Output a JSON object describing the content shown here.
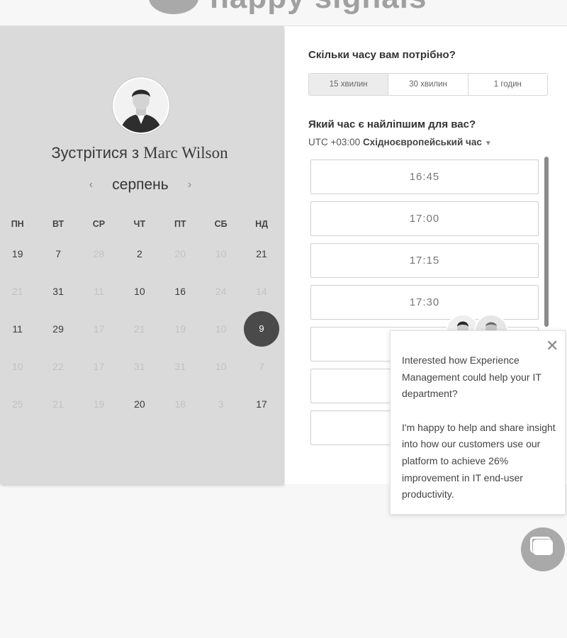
{
  "header": {
    "logo_text": "happy signals"
  },
  "booking": {
    "meet_prefix": "Зустрітися з",
    "host_name": "Marc Wilson",
    "month": "серпень",
    "prev_arrow": "‹",
    "next_arrow": "›"
  },
  "calendar": {
    "weekdays": [
      "ПН",
      "ВТ",
      "СР",
      "ЧТ",
      "ПТ",
      "СБ",
      "НД"
    ],
    "rows": [
      [
        {
          "d": "19",
          "m": false
        },
        {
          "d": "7",
          "m": false
        },
        {
          "d": "28",
          "m": true
        },
        {
          "d": "2",
          "m": false
        },
        {
          "d": "20",
          "m": true
        },
        {
          "d": "10",
          "m": true
        },
        {
          "d": "21",
          "m": false
        }
      ],
      [
        {
          "d": "21",
          "m": true
        },
        {
          "d": "31",
          "m": false
        },
        {
          "d": "11",
          "m": true
        },
        {
          "d": "10",
          "m": false
        },
        {
          "d": "16",
          "m": false
        },
        {
          "d": "24",
          "m": true
        },
        {
          "d": "14",
          "m": true
        }
      ],
      [
        {
          "d": "11",
          "m": false
        },
        {
          "d": "29",
          "m": false
        },
        {
          "d": "17",
          "m": true
        },
        {
          "d": "21",
          "m": true
        },
        {
          "d": "19",
          "m": true
        },
        {
          "d": "10",
          "m": true
        },
        {
          "d": "9",
          "m": false,
          "sel": true
        }
      ],
      [
        {
          "d": "10",
          "m": true
        },
        {
          "d": "22",
          "m": true
        },
        {
          "d": "17",
          "m": true
        },
        {
          "d": "31",
          "m": true
        },
        {
          "d": "31",
          "m": true
        },
        {
          "d": "10",
          "m": true
        },
        {
          "d": "7",
          "m": true
        }
      ],
      [
        {
          "d": "25",
          "m": true
        },
        {
          "d": "21",
          "m": true
        },
        {
          "d": "19",
          "m": true
        },
        {
          "d": "20",
          "m": false
        },
        {
          "d": "18",
          "m": true
        },
        {
          "d": "3",
          "m": true
        },
        {
          "d": "17",
          "m": false
        }
      ]
    ]
  },
  "duration": {
    "question": "Скільки часу вам потрібно?",
    "options": [
      "15 хвилин",
      "30 хвилин",
      "1 годин"
    ],
    "selected": "15 хвилин"
  },
  "time": {
    "question": "Який час є найліпшим для вас?",
    "tz_offset": "UTC +03:00",
    "tz_name": "Східноєвропейський час",
    "slots": [
      "16:45",
      "17:00",
      "17:15",
      "17:30",
      "",
      "",
      "",
      ""
    ]
  },
  "popup": {
    "line1": "Interested how Experience Management could help your IT department?",
    "line2": "I'm happy to help and share insight into how our customers use our platform to achieve 26% improvement in IT end-user productivity.",
    "close": "✕"
  },
  "colors": {
    "selected_day": "#4a4a4a",
    "left_panel": "#dadada"
  }
}
